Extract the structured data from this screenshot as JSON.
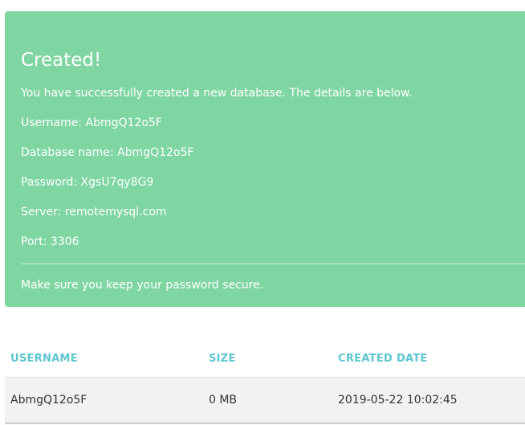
{
  "alert": {
    "title": "Created!",
    "intro": "You have successfully created a new database. The details are below.",
    "username_line": "Username: AbmgQ12o5F",
    "database_line": "Database name: AbmgQ12o5F",
    "password_line": "Password: XgsU7qy8G9",
    "server_line": "Server: remotemysql.com",
    "port_line": "Port: 3306",
    "security_note": "Make sure you keep your password secure.",
    "background_color": "#7fd6a3"
  },
  "table": {
    "headers": {
      "username": "USERNAME",
      "size": "SIZE",
      "created_date": "CREATED DATE"
    },
    "header_color": "#5cc6cf",
    "rows": [
      {
        "username": "AbmgQ12o5F",
        "size": "0 MB",
        "created_date": "2019-05-22 10:02:45"
      }
    ]
  }
}
